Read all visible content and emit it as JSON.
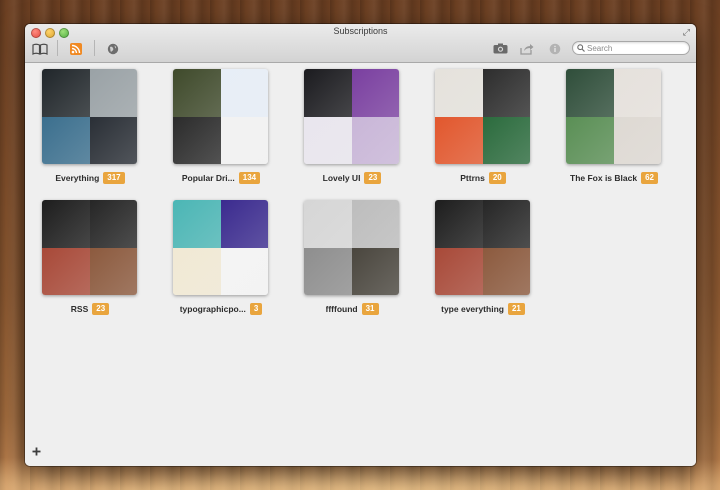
{
  "window": {
    "title": "Subscriptions"
  },
  "search": {
    "placeholder": "Search"
  },
  "toolbar": {
    "left_icons": [
      "book-icon",
      "rss-icon",
      "globe-icon"
    ],
    "right_icons": [
      "camera-icon",
      "share-icon",
      "info-icon"
    ]
  },
  "subscriptions": [
    {
      "name": "Everything",
      "count": "317",
      "colors": [
        "#20262a",
        "#9aa2a6",
        "#3b6f8e",
        "#2a2f36"
      ]
    },
    {
      "name": "Popular Dri...",
      "count": "134",
      "colors": [
        "#3f4a2b",
        "#e7eef7",
        "#2b2b2b",
        "#f2f2f2"
      ]
    },
    {
      "name": "Lovely UI",
      "count": "23",
      "colors": [
        "#1b1b1f",
        "#7a3fa0",
        "#e9e6ee",
        "#c9b6d8"
      ]
    },
    {
      "name": "Pttrns",
      "count": "20",
      "colors": [
        "#e5e2dc",
        "#2d2d2d",
        "#e2572d",
        "#2b6b3d"
      ]
    },
    {
      "name": "The Fox is Black",
      "count": "62",
      "colors": [
        "#2f4e3a",
        "#e6e1dc",
        "#5a8f55",
        "#ded9d3"
      ]
    },
    {
      "name": "RSS",
      "count": "23",
      "colors": [
        "#1d1d1d",
        "#262626",
        "#a84938",
        "#8c5a3e"
      ]
    },
    {
      "name": "typographicpo...",
      "count": "3",
      "colors": [
        "#4bb6b5",
        "#3b2b8f",
        "#f1e9d4",
        "#f4f4f4"
      ]
    },
    {
      "name": "ffffound",
      "count": "31",
      "colors": [
        "#d6d6d6",
        "#bdbdbd",
        "#8e8e8e",
        "#4a463e"
      ]
    },
    {
      "name": "type everything",
      "count": "21",
      "colors": [
        "#1d1d1d",
        "#262626",
        "#a84938",
        "#8c5a3e"
      ]
    }
  ]
}
